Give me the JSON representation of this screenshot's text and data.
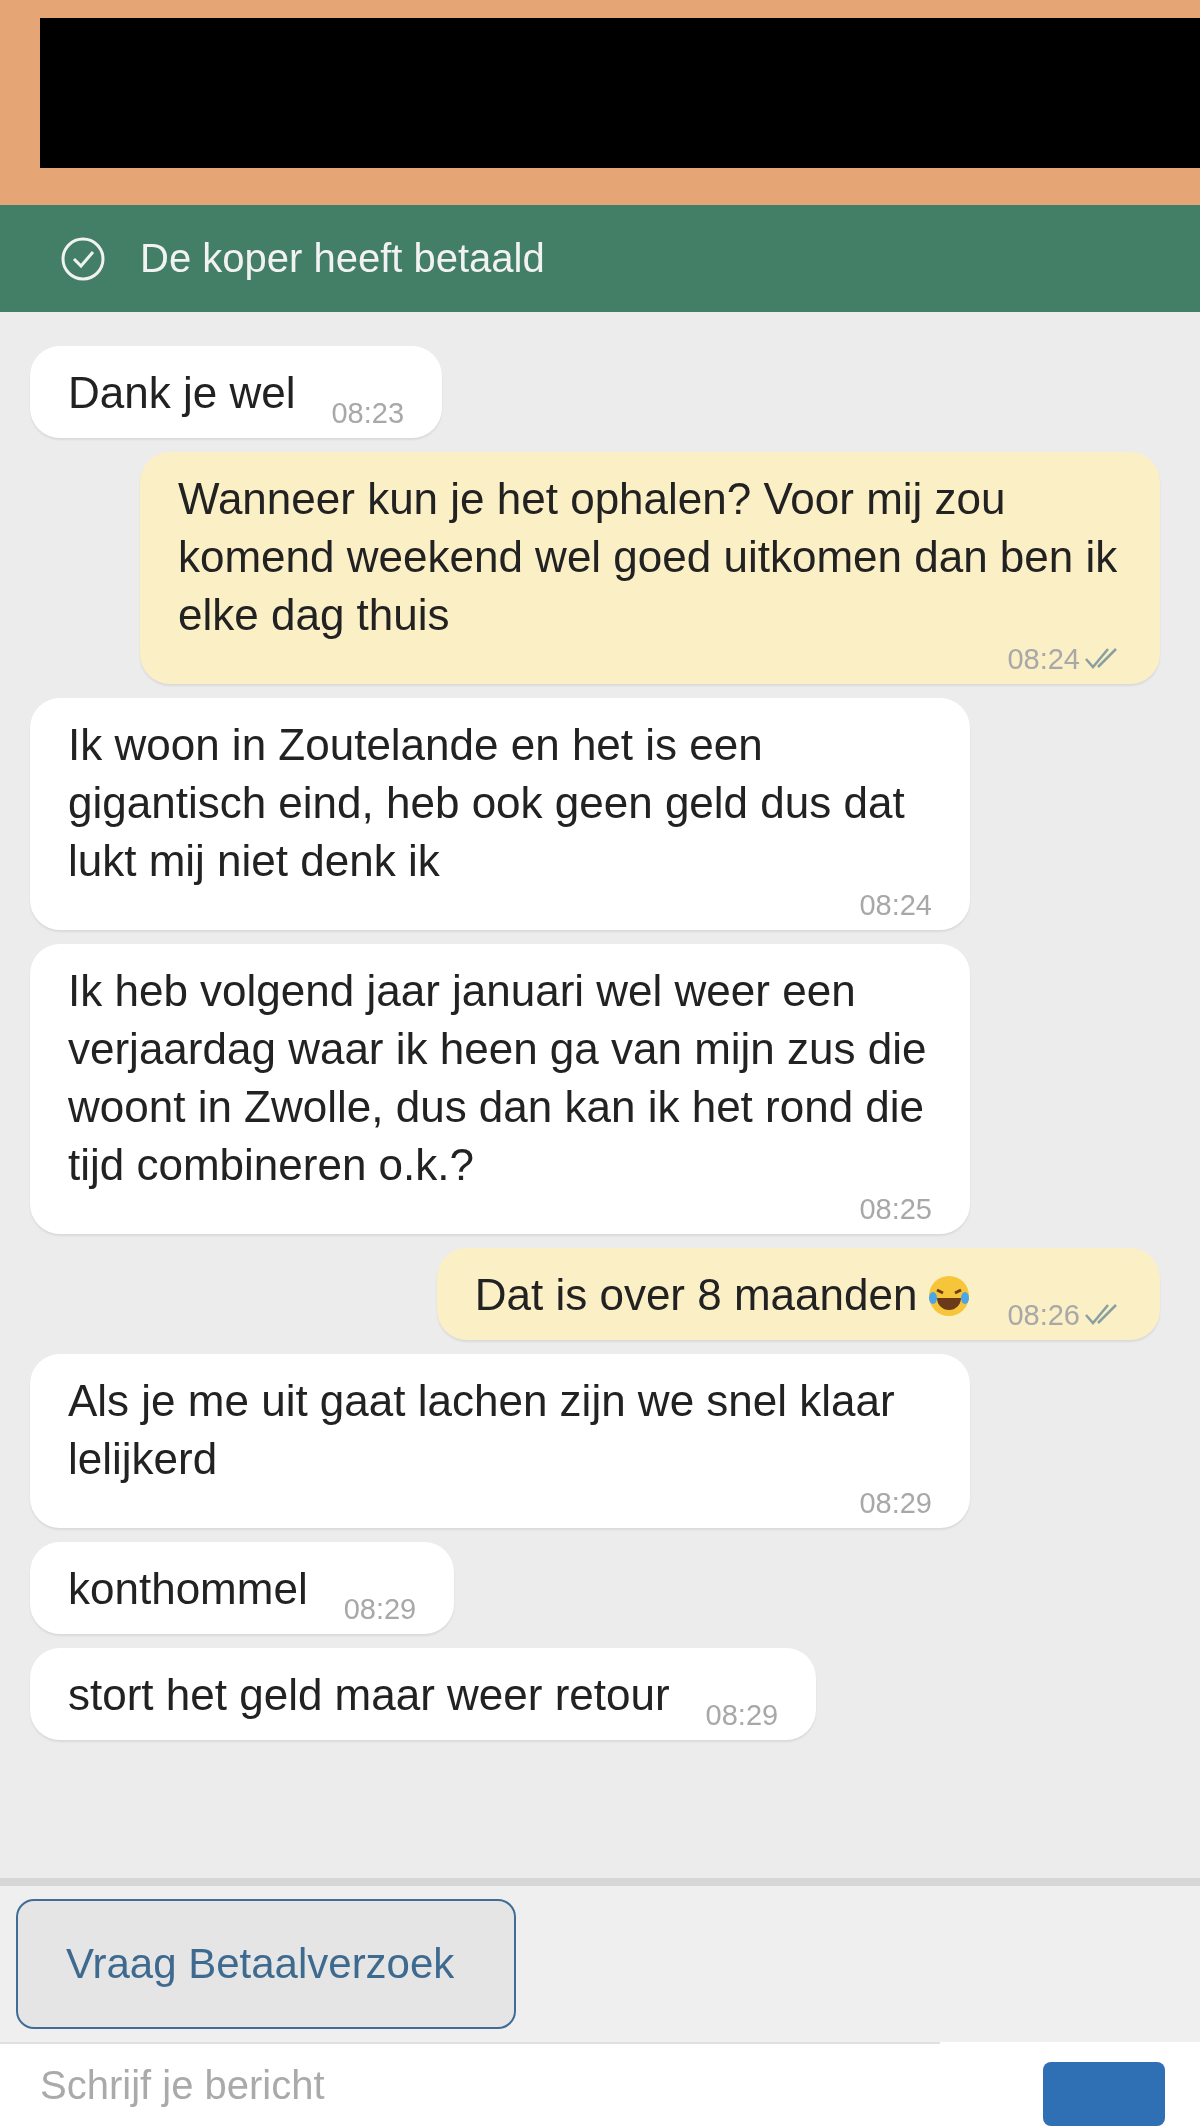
{
  "status_banner": {
    "text": "De koper heeft betaald",
    "paid": true
  },
  "messages": [
    {
      "kind": "received",
      "text": "Dank je wel",
      "time": "08:23"
    },
    {
      "kind": "sent",
      "text": "Wanneer kun je het ophalen? Voor mij zou komend weekend wel goed uitkomen dan ben ik elke dag thuis",
      "time": "08:24",
      "read": true
    },
    {
      "kind": "received",
      "text": "Ik woon in Zoutelande en het is een gigantisch eind, heb ook geen geld dus dat lukt mij niet denk ik",
      "time": "08:24"
    },
    {
      "kind": "received",
      "text": "Ik heb volgend jaar januari wel weer een verjaardag waar ik heen ga van mijn zus die woont in Zwolle, dus dan kan ik het rond die tijd combineren o.k.?",
      "time": "08:25"
    },
    {
      "kind": "sent",
      "text": "Dat is over 8 maanden",
      "emoji": true,
      "time": "08:26",
      "read": true
    },
    {
      "kind": "received",
      "text": "Als je me uit gaat lachen zijn we snel klaar lelijkerd",
      "time": "08:29"
    },
    {
      "kind": "received",
      "text": "konthommel",
      "time": "08:29"
    },
    {
      "kind": "received",
      "text": "stort het geld maar weer retour",
      "time": "08:29"
    }
  ],
  "action_button": "Vraag Betaalverzoek",
  "composer": {
    "placeholder": "Schrijf je bericht"
  }
}
